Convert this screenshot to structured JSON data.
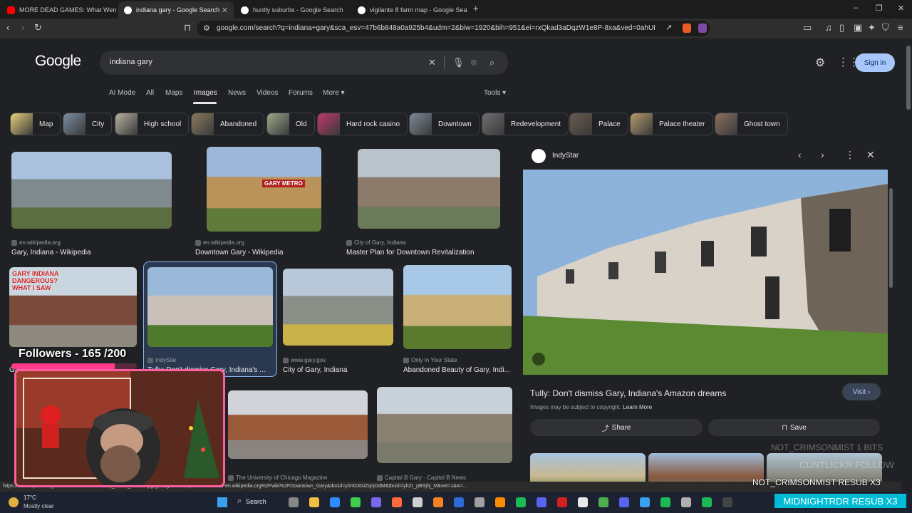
{
  "tabs": [
    {
      "title": "MORE DEAD GAMES: What Went Wr",
      "active": false,
      "favicon_color": "#ff0000"
    },
    {
      "title": "indiana gary - Google Search",
      "active": true,
      "favicon_color": "#ffffff"
    },
    {
      "title": "huntly suburbs - Google Search",
      "active": false,
      "favicon_color": "#ffffff"
    },
    {
      "title": "vigilante 8 farm map - Google Search",
      "active": false,
      "favicon_color": "#ffffff"
    }
  ],
  "new_tab_label": "+",
  "window_controls": {
    "minimize": "–",
    "maximize": "❐",
    "close": "✕"
  },
  "address_bar": {
    "url": "google.com/search?q=indiana+gary&sca_esv=47b6b848a0a925b4&udm=2&biw=1920&bih=951&ei=rxQkad3aDqzW1e8P-8xa&ved=0ahUKEwid7v..."
  },
  "google": {
    "logo": "Google",
    "query": "indiana gary",
    "signin_label": "Sign in",
    "nav_tabs": [
      "AI Mode",
      "All",
      "Maps",
      "Images",
      "News",
      "Videos",
      "Forums",
      "More ▾"
    ],
    "active_tab": "Images",
    "tools_label": "Tools ▾"
  },
  "chips": [
    {
      "label": "Map",
      "color": "#e8d27a"
    },
    {
      "label": "City",
      "color": "#7a8da0"
    },
    {
      "label": "High school",
      "color": "#b7b0a2"
    },
    {
      "label": "Abandoned",
      "color": "#8a7a5e"
    },
    {
      "label": "Old",
      "color": "#9aa88a"
    },
    {
      "label": "Hard rock casino",
      "color": "#c0386a"
    },
    {
      "label": "Downtown",
      "color": "#7c8a98"
    },
    {
      "label": "Redevelopment",
      "color": "#6f6f72"
    },
    {
      "label": "Palace",
      "color": "#6a5a4e"
    },
    {
      "label": "Palace theater",
      "color": "#b59a6a"
    },
    {
      "label": "Ghost town",
      "color": "#8a7060"
    }
  ],
  "results": [
    {
      "source": "en.wikipedia.org",
      "title": "Gary, Indiana - Wikipedia",
      "colors": [
        "#a9c1dc",
        "#7f8a8f",
        "#5b6e3f"
      ]
    },
    {
      "source": "en.wikipedia.org",
      "title": "Downtown Gary - Wikipedia",
      "colors": [
        "#9cb7d8",
        "#b9935a",
        "#5f7a3a"
      ],
      "overlay_text": "GARY METRO"
    },
    {
      "source": "City of Gary, Indiana",
      "title": "Master Plan for Downtown Revitalization",
      "colors": [
        "#b9c3c9",
        "#8c7a6a",
        "#6a7a5a"
      ]
    },
    {
      "source": "",
      "title": "Gary, Indiana, The City Of The Centur...",
      "colors": [
        "#c9d6e0",
        "#7a4a3a",
        "#8e8a80"
      ],
      "overlay_text": "GARY INDIANA DANGEROUS? WHAT I SAW"
    },
    {
      "source": "IndyStar",
      "title": "Tully: Don't dismiss Gary, Indiana's Amazon ...",
      "colors": [
        "#9ab8d8",
        "#c8c0b8",
        "#4f7a2e"
      ]
    },
    {
      "source": "www.gary.gov",
      "title": "City of Gary, Indiana",
      "colors": [
        "#b8c8d8",
        "#8a9088",
        "#c9b24a"
      ]
    },
    {
      "source": "Only In Your State",
      "title": "Abandoned Beauty of Gary, Indi...",
      "colors": [
        "#a8c8e8",
        "#c8b078",
        "#5a7a2e"
      ]
    },
    {
      "source": "The University of Chicago Magazine",
      "title": "",
      "colors": [
        "#d0d4d8",
        "#9a5a3a",
        "#8a8480"
      ]
    },
    {
      "source": "Capital B Gary - Capital B News",
      "title": "",
      "colors": [
        "#c8d0d8",
        "#8a8070",
        "#7a7a6a"
      ]
    }
  ],
  "panel": {
    "source": "IndyStar",
    "title": "Tully: Don't dismiss Gary, Indiana's Amazon dreams",
    "copyright": "Images may be subject to copyright.",
    "learn_more": "Learn More",
    "visit_label": "Visit ›",
    "share_label": "Share",
    "save_label": "Save",
    "image_colors": [
      "#8eb3da",
      "#d8d2c8",
      "#5c8a32"
    ]
  },
  "status_url": "https://en.wikipedia.org%2Fwiki%2FFile%3AGary_Metro_Gateway.jpg&imgrefurl=https%3A%2F%2Fen.wikipedia.org%2Fwiki%2FDowntown_Gary&docid=y0nG3GiZqnjOdM&tbnid=iyhZr_pBSjhj_M&vet=1&w=...",
  "stream": {
    "followers_text": "Followers - 165 /200",
    "followers_progress": 0.825,
    "sub_banner": "MIDNIGHTRDR  RESUB X3",
    "ghost_lines": [
      "NOT_CRIMSONMIST  1 BITS",
      "CUNTLICKR  FOLLOW"
    ],
    "sub_line": "NOT_CRIMSONMIST RESUB X3"
  },
  "taskbar": {
    "temp": "17°C",
    "weather": "Mostly clear",
    "search_label": "Search"
  }
}
